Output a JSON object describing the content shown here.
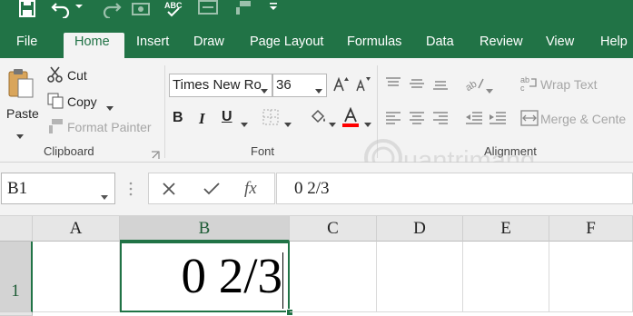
{
  "ribbon_tabs": [
    "File",
    "Home",
    "Insert",
    "Draw",
    "Page Layout",
    "Formulas",
    "Data",
    "Review",
    "View",
    "Help"
  ],
  "active_tab": "Home",
  "clipboard": {
    "paste_label": "Paste",
    "cut_label": "Cut",
    "copy_label": "Copy",
    "format_painter_label": "Format Painter",
    "group_label": "Clipboard"
  },
  "font": {
    "font_name": "Times New Ro",
    "font_size": "36",
    "group_label": "Font"
  },
  "alignment": {
    "wrap_text_label": "Wrap Text",
    "merge_label": "Merge & Cente",
    "group_label": "Alignment"
  },
  "formula_bar": {
    "name_box": "B1",
    "formula": "0 2/3"
  },
  "sheet": {
    "columns": [
      "A",
      "B",
      "C",
      "D",
      "E",
      "F"
    ],
    "rows": [
      "1"
    ],
    "selected_cell": "B1",
    "cells": {
      "B1": "0 2/3"
    }
  },
  "watermark": "Quantrimang",
  "colors": {
    "accent": "#217346",
    "font_color": "#ff0000"
  }
}
